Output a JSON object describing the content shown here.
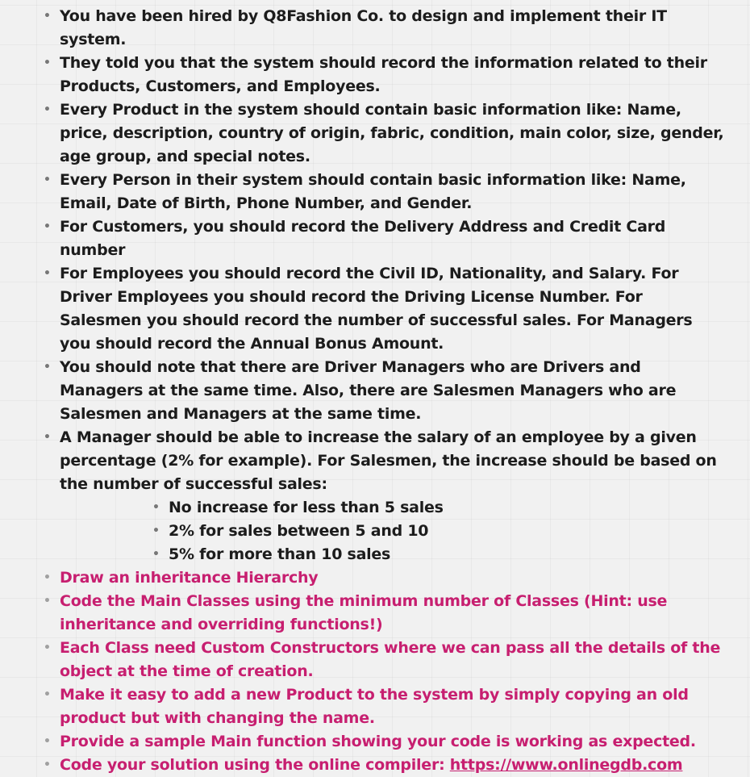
{
  "items": [
    {
      "text": "You have been hired by Q8Fashion Co. to design and implement their IT system."
    },
    {
      "text": "They told you that the system should record the information related to their Products, Customers, and Employees."
    },
    {
      "text": "Every Product in the system should contain basic information like: Name, price, description, country of origin, fabric, condition, main color, size, gender, age group, and special notes."
    },
    {
      "text": "Every Person in their system should contain basic information like: Name, Email, Date of Birth,  Phone Number, and Gender."
    },
    {
      "text": "For Customers, you should record the Delivery Address and Credit Card number"
    },
    {
      "text": "For Employees you should record the Civil ID, Nationality, and Salary. For Driver Employees you should record the Driving License Number. For Salesmen you should record the number of successful sales. For Managers you should record the Annual Bonus Amount."
    },
    {
      "text": "You should note that there are Driver Managers who are Drivers and Managers at the same time. Also, there are Salesmen Managers who are Salesmen and Managers at the same time."
    },
    {
      "text": "A Manager should be able to increase the salary of an employee by a given percentage (2% for example). For Salesmen, the increase should be based on the number of successful sales:"
    }
  ],
  "sub_items": [
    {
      "text": "No increase for less than 5 sales"
    },
    {
      "text": "2% for sales between 5 and 10"
    },
    {
      "text": "5% for more than 10 sales"
    }
  ],
  "tasks": [
    {
      "text": "Draw an inheritance Hierarchy"
    },
    {
      "text": "Code the Main Classes using the minimum number of Classes (Hint: use inheritance and overriding functions!)"
    },
    {
      "text": "Each Class need Custom Constructors where we can pass all the details of the object at the time of creation."
    },
    {
      "text": "Make it easy to add a new Product to the system by simply copying an old product but with changing the name."
    },
    {
      "text": "Provide a sample Main function showing your code is working as expected."
    }
  ],
  "last_task": {
    "text": "Code your solution using the online compiler: ",
    "link": "https://www.onlinegdb.com"
  },
  "bullet_char": "•",
  "colors": {
    "task_text": "#c71f70",
    "body_text": "#1c1c1c",
    "background": "#f1f1f1"
  }
}
